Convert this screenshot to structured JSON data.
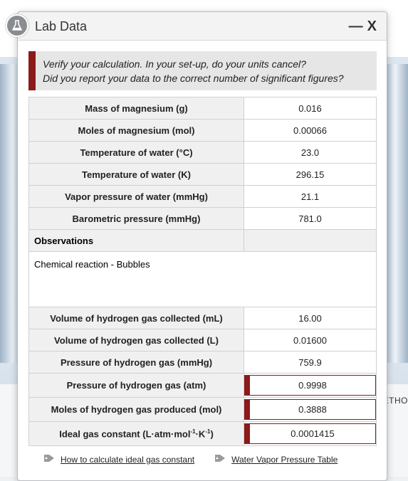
{
  "background": {
    "edge_text": "ETHO"
  },
  "dialog": {
    "title": "Lab Data",
    "minimize_label": "—",
    "close_label": "X",
    "icon": "flask-icon"
  },
  "notice": {
    "line1": "Verify your calculation. In your set-up, do your units cancel?",
    "line2": "Did you report your data to the correct number of significant figures?"
  },
  "table": {
    "rows": [
      {
        "label": "Mass of magnesium (g)",
        "value": "0.016"
      },
      {
        "label": "Moles of magnesium (mol)",
        "value": "0.00066"
      },
      {
        "label": "Temperature of water (°C)",
        "value": "23.0"
      },
      {
        "label": "Temperature of water (K)",
        "value": "296.15"
      },
      {
        "label": "Vapor pressure of water (mmHg)",
        "value": "21.1"
      },
      {
        "label": "Barometric pressure (mmHg)",
        "value": "781.0"
      }
    ],
    "observations_label": "Observations",
    "observations_text": "Chemical reaction - Bubbles",
    "rows2": [
      {
        "label": "Volume of hydrogen gas collected (mL)",
        "value": "16.00"
      },
      {
        "label": "Volume of hydrogen gas collected (L)",
        "value": "0.01600"
      },
      {
        "label": "Pressure of hydrogen gas (mmHg)",
        "value": "759.9"
      }
    ],
    "inputs": [
      {
        "label": "Pressure of hydrogen gas (atm)",
        "value": "0.9998"
      },
      {
        "label": "Moles of hydrogen gas produced (mol)",
        "value": "0.3888"
      }
    ],
    "gas_constant": {
      "label_prefix": "Ideal gas constant (L",
      "dot": "·",
      "atm": "atm",
      "mol": "mol",
      "exp": "-1",
      "k": "K",
      "suffix": ")",
      "value": "0.0001415"
    }
  },
  "links": [
    {
      "label": "How to calculate ideal gas constant",
      "icon": "tag-icon"
    },
    {
      "label": "Water Vapor Pressure Table",
      "icon": "tag-icon"
    }
  ],
  "colors": {
    "accent": "#8b1a1a",
    "icon_gray": "#8a8d90"
  }
}
